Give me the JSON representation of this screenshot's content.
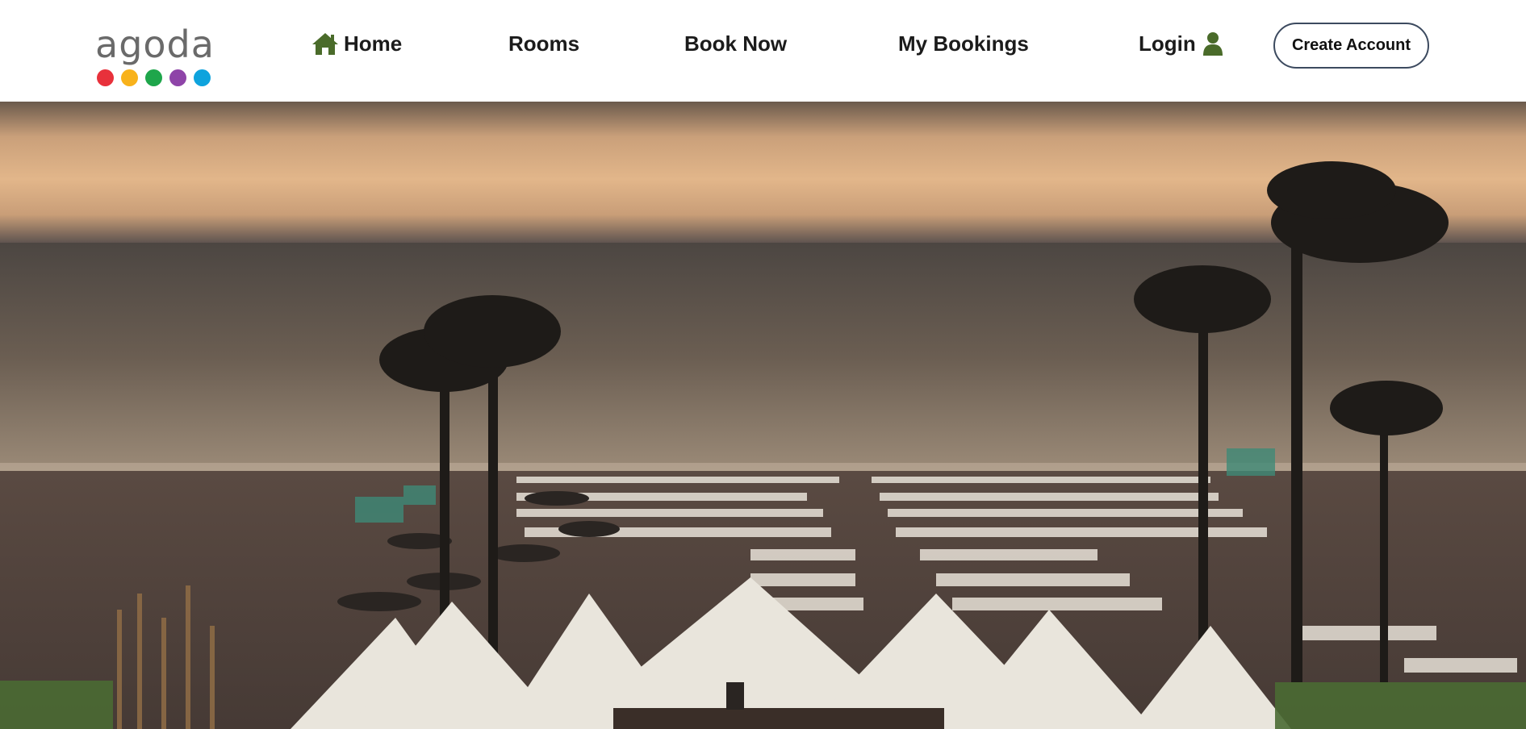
{
  "logo": {
    "text": "agoda",
    "dot_colors": [
      "#e8313b",
      "#f8b21b",
      "#1ea64b",
      "#8e44a8",
      "#0ea3dd"
    ]
  },
  "nav": {
    "home": {
      "label": "Home",
      "icon": "home-icon"
    },
    "rooms": {
      "label": "Rooms"
    },
    "book_now": {
      "label": "Book Now"
    },
    "my_bookings": {
      "label": "My Bookings"
    },
    "login": {
      "label": "Login",
      "icon": "user-icon"
    },
    "create_account": {
      "label": "Create Account"
    }
  },
  "colors": {
    "icon_green": "#4a6b2a",
    "button_border": "#3c4a5f"
  },
  "hero": {
    "image": "beach-resort-sunset"
  }
}
